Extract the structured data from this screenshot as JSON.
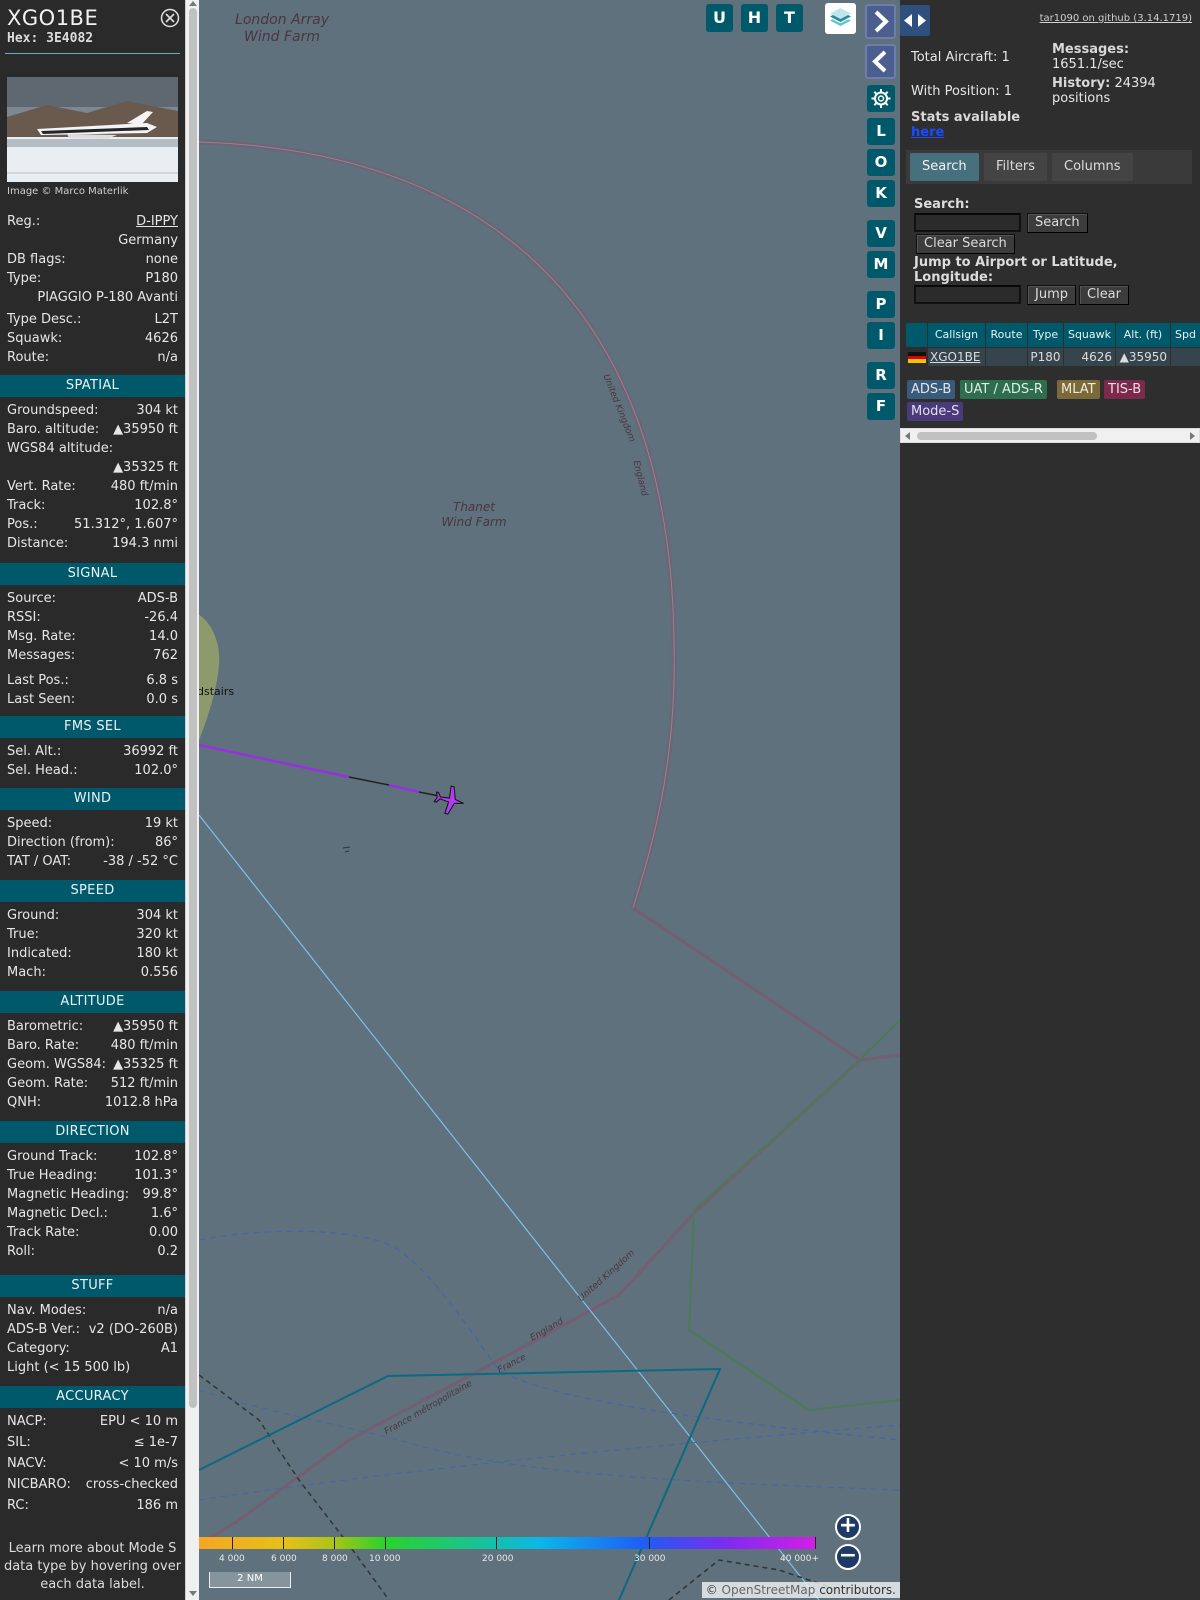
{
  "info": {
    "callsign": "XGO1BE",
    "hex": "Hex: 3E4082",
    "photo_credit": "Image © Marco Materlik",
    "basic": [
      {
        "label": "Reg.:",
        "value": "D-IPPY"
      },
      {
        "label": "",
        "value": "Germany"
      },
      {
        "label": "DB flags:",
        "value": "none"
      },
      {
        "label": "Type:",
        "value": "P180"
      },
      {
        "label": "",
        "value": "PIAGGIO P-180 Avanti"
      },
      {
        "label": "Type Desc.:",
        "value": "L2T"
      },
      {
        "label": "Squawk:",
        "value": "4626"
      },
      {
        "label": "Route:",
        "value": "n/a"
      }
    ],
    "sections": [
      {
        "title": "SPATIAL",
        "rows": [
          {
            "label": "Groundspeed:",
            "value": "304 kt"
          },
          {
            "label": "Baro. altitude:",
            "value": "▲35950 ft"
          },
          {
            "label": "WGS84 altitude:",
            "value": ""
          },
          {
            "label": "",
            "value": "▲35325 ft"
          },
          {
            "label": "Vert. Rate:",
            "value": "480 ft/min"
          },
          {
            "label": "Track:",
            "value": "102.8°"
          },
          {
            "label": "Pos.:",
            "value": "51.312°, 1.607°"
          },
          {
            "label": "Distance:",
            "value": "194.3 nmi"
          }
        ]
      },
      {
        "title": "SIGNAL",
        "rows": [
          {
            "label": "Source:",
            "value": "ADS-B"
          },
          {
            "label": "RSSI:",
            "value": "-26.4"
          },
          {
            "label": "Msg. Rate:",
            "value": "14.0"
          },
          {
            "label": "Messages:",
            "value": "762"
          },
          {
            "label": "Last Pos.:",
            "value": "6.8 s"
          },
          {
            "label": "Last Seen:",
            "value": "0.0 s"
          }
        ]
      },
      {
        "title": "FMS SEL",
        "rows": [
          {
            "label": "Sel. Alt.:",
            "value": "36992 ft"
          },
          {
            "label": "Sel. Head.:",
            "value": "102.0°"
          }
        ]
      },
      {
        "title": "WIND",
        "rows": [
          {
            "label": "Speed:",
            "value": "19 kt"
          },
          {
            "label": "Direction (from):",
            "value": "86°"
          },
          {
            "label": "TAT / OAT:",
            "value": "-38 / -52 °C"
          }
        ]
      },
      {
        "title": "SPEED",
        "rows": [
          {
            "label": "Ground:",
            "value": "304 kt"
          },
          {
            "label": "True:",
            "value": "320 kt"
          },
          {
            "label": "Indicated:",
            "value": "180 kt"
          },
          {
            "label": "Mach:",
            "value": "0.556"
          }
        ]
      },
      {
        "title": "ALTITUDE",
        "rows": [
          {
            "label": "Barometric:",
            "value": "▲35950 ft"
          },
          {
            "label": "Baro. Rate:",
            "value": "480 ft/min"
          },
          {
            "label": "Geom. WGS84:",
            "value": "▲35325 ft"
          },
          {
            "label": "Geom. Rate:",
            "value": "512 ft/min"
          },
          {
            "label": "QNH:",
            "value": "1012.8 hPa"
          }
        ]
      },
      {
        "title": "DIRECTION",
        "rows": [
          {
            "label": "Ground Track:",
            "value": "102.8°"
          },
          {
            "label": "True Heading:",
            "value": "101.3°"
          },
          {
            "label": "Magnetic Heading:",
            "value": "99.8°"
          },
          {
            "label": "Magnetic Decl.:",
            "value": "1.6°"
          },
          {
            "label": "Track Rate:",
            "value": "0.00"
          },
          {
            "label": "Roll:",
            "value": "0.2"
          }
        ]
      },
      {
        "title": "STUFF",
        "rows": [
          {
            "label": "Nav. Modes:",
            "value": "n/a"
          },
          {
            "label": "ADS-B Ver.:",
            "value": "v2 (DO-260B)"
          },
          {
            "label": "Category:",
            "value": "A1"
          },
          {
            "label": "Light (< 15 500 lb)",
            "value": ""
          }
        ]
      },
      {
        "title": "ACCURACY",
        "rows": [
          {
            "label": "NACP:",
            "value": "EPU < 10 m"
          },
          {
            "label": "SIL:",
            "value": "≤ 1e-7"
          },
          {
            "label": "NACV:",
            "value": "< 10 m/s"
          },
          {
            "label": "NICBARO:",
            "value": "cross-checked"
          },
          {
            "label": "RC:",
            "value": "186 m"
          }
        ]
      }
    ],
    "learn_more": "Learn more about Mode S data type by hovering over each data label."
  },
  "map": {
    "labels": {
      "london_array": "London Array Wind Farm",
      "thanet": "Thanet Wind Farm",
      "broadstairs": "dstairs",
      "uk1": "United Kingdom",
      "england1": "England",
      "uk2": "United Kingdom",
      "england2": "England",
      "france": "France",
      "france_metro": "France métropolitaine"
    },
    "buttons": {
      "u": "U",
      "h": "H",
      "t": "T",
      "l": "L",
      "o": "O",
      "k": "K",
      "v": "V",
      "m": "M",
      "p": "P",
      "i": "I",
      "r": "R",
      "f": "F"
    },
    "colorbar_labels": [
      "4 000",
      "6 000",
      "8 000",
      "10 000",
      "20 000",
      "30 000",
      "40 000+"
    ],
    "scale": "2 NM",
    "attribution_pre": "© ",
    "attribution_link": "OpenStreetMap",
    "attribution_post": " contributors."
  },
  "right": {
    "github": "tar1090 on github (3.14.1719)",
    "total_aircraft": "Total Aircraft: 1",
    "with_position": "With Position: 1",
    "stats_available": "Stats available",
    "here": "here",
    "messages_label": "Messages:",
    "messages_value": "1651.1/sec",
    "history_label": "History:",
    "history_value": "24394",
    "history_unit": "positions",
    "tabs": [
      "Search",
      "Filters",
      "Columns"
    ],
    "search_label": "Search:",
    "search_button": "Search",
    "clear_search_button": "Clear Search",
    "jump_label": "Jump to Airport or Latitude, Longitude:",
    "jump_button": "Jump",
    "clear_button": "Clear",
    "table": {
      "headers": [
        "Callsign",
        "Route",
        "Type",
        "Squawk",
        "Alt. (ft)",
        "Spd"
      ],
      "row": {
        "callsign": "XGO1BE",
        "route": "",
        "type": "P180",
        "squawk": "4626",
        "alt": "▲35950",
        "spd": ""
      }
    },
    "sources": [
      "ADS-B",
      "UAT / ADS-R",
      "MLAT",
      "TIS-B",
      "Mode-S"
    ],
    "colors": {
      "adsb": "#3a5a7a",
      "uat": "#2e6e4e",
      "mlat": "#7a6a3a",
      "tisb": "#7a2a4a",
      "modes": "#4a3a7a"
    }
  }
}
